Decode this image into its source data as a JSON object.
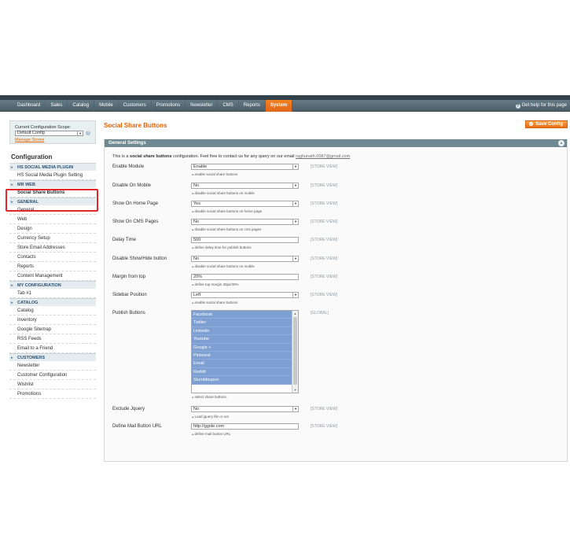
{
  "nav": {
    "items": [
      "Dashboard",
      "Sales",
      "Catalog",
      "Mobile",
      "Customers",
      "Promotions",
      "Newsletter",
      "CMS",
      "Reports",
      "System"
    ],
    "active": "System",
    "help": "Get help for this page"
  },
  "sidebar": {
    "scope_label": "Current Configuration Scope:",
    "scope_value": "Default Config",
    "manage_stores": "Manage Stores",
    "title": "Configuration",
    "sections": [
      {
        "header": "HS SOCIAL MEDIA PLUGIN",
        "items": [
          "HS Social Media Plugin Setting"
        ]
      },
      {
        "header": "MR WEB",
        "items": [
          "Social Share Buttons"
        ]
      },
      {
        "header": "GENERAL",
        "items": [
          "General",
          "Web",
          "Design",
          "Currency Setup",
          "Store Email Addresses",
          "Contacts",
          "Reports",
          "Content Management"
        ]
      },
      {
        "header": "MY CONFIGURATION",
        "items": [
          "Tab #1"
        ]
      },
      {
        "header": "CATALOG",
        "items": [
          "Catalog",
          "Inventory",
          "Google Sitemap",
          "RSS Feeds",
          "Email to a Friend"
        ]
      },
      {
        "header": "CUSTOMERS",
        "items": [
          "Newsletter",
          "Customer Configuration",
          "Wishlist",
          "Promotions"
        ]
      }
    ],
    "active_item": "Social Share Buttons"
  },
  "main": {
    "title": "Social Share Buttons",
    "save_label": "Save Config",
    "panel_title": "General Settings",
    "intro_prefix": "This is a ",
    "intro_bold": "social share buttons",
    "intro_suffix": " configuration. Feel free to contact us for any query on our email ",
    "intro_email": "raghunath.0087@gmail.com",
    "fields": [
      {
        "label": "Enable Module",
        "value": "Enable",
        "type": "select",
        "note": "enable social share buttons",
        "scope": "[STORE VIEW]"
      },
      {
        "label": "Disable On Mobile",
        "value": "No",
        "type": "select",
        "note": "disable social share buttons on mobile",
        "scope": "[STORE VIEW]"
      },
      {
        "label": "Show On Home Page",
        "value": "Yes",
        "type": "select",
        "note": "disable social share buttons on home page",
        "scope": "[STORE VIEW]"
      },
      {
        "label": "Show On CMS Pages",
        "value": "No",
        "type": "select",
        "note": "disable social share buttons on cms pages",
        "scope": "[STORE VIEW]"
      },
      {
        "label": "Delay Time",
        "value": "500",
        "type": "text",
        "note": "define delay time for publish buttons",
        "scope": "[STORE VIEW]"
      },
      {
        "label": "Disable Show/Hide button",
        "value": "No",
        "type": "select",
        "note": "disable social share buttons on mobile",
        "scope": "[STORE VIEW]"
      },
      {
        "label": "Margin from top",
        "value": "20%",
        "type": "text",
        "note": "define top margin 30px/30%",
        "scope": "[STORE VIEW]"
      },
      {
        "label": "Sidebar Position",
        "value": "Left",
        "type": "select",
        "note": "enable social share buttons",
        "scope": "[STORE VIEW]"
      }
    ],
    "publish": {
      "label": "Publish Buttons",
      "options": [
        "Facebook",
        "Twitter",
        "Linkedin",
        "Youtube",
        "Google +",
        "Pinterest",
        "Email",
        "Reddit",
        "Stumbleupon"
      ],
      "note": "select share buttons.",
      "scope": "[GLOBAL]"
    },
    "fields2": [
      {
        "label": "Exclude Jquery",
        "value": "No",
        "type": "select",
        "note": "Load jquery file or not",
        "scope": "[STORE VIEW]"
      },
      {
        "label": "Define Mail Button URL",
        "value": "http://ggole.com",
        "type": "text",
        "note": "define mail button URL",
        "scope": "[STORE VIEW]"
      }
    ]
  },
  "colors": {
    "accent": "#eb5e00",
    "nav_bg": "#5a6f7a",
    "panel_head": "#6f8992",
    "selected_option": "#7d9fd1",
    "highlight_box": "#e2262a"
  }
}
